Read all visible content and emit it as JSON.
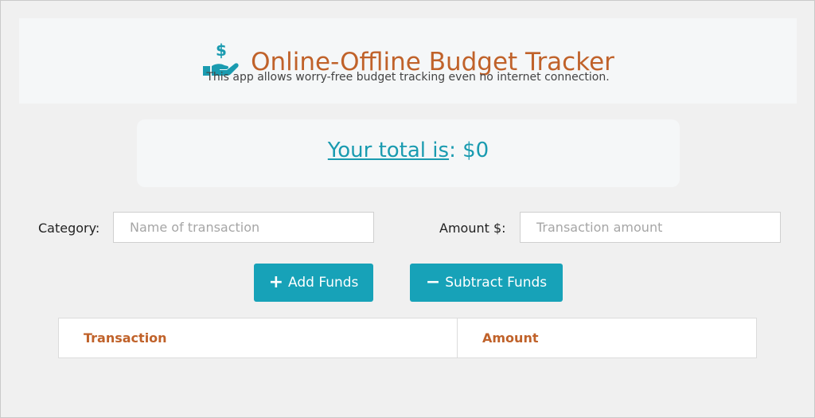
{
  "header": {
    "title": "Online-Offline Budget Tracker",
    "subtitle": "This app allows worry-free budget tracking even no internet connection.",
    "logo_icon": "hand-dollar-icon",
    "accent_color": "#c0622a",
    "icon_color": "#1a9bb0"
  },
  "total": {
    "label": "Your total is",
    "separator": ":",
    "value": "$0"
  },
  "form": {
    "category_label": "Category:",
    "category_placeholder": "Name of transaction",
    "category_value": "",
    "amount_label": "Amount $:",
    "amount_placeholder": "Transaction amount",
    "amount_value": ""
  },
  "buttons": {
    "add_label": "Add Funds",
    "add_icon": "plus-icon",
    "subtract_label": "Subtract Funds",
    "subtract_icon": "minus-icon",
    "color": "#17a2b8"
  },
  "table": {
    "columns": [
      "Transaction",
      "Amount"
    ],
    "rows": []
  }
}
